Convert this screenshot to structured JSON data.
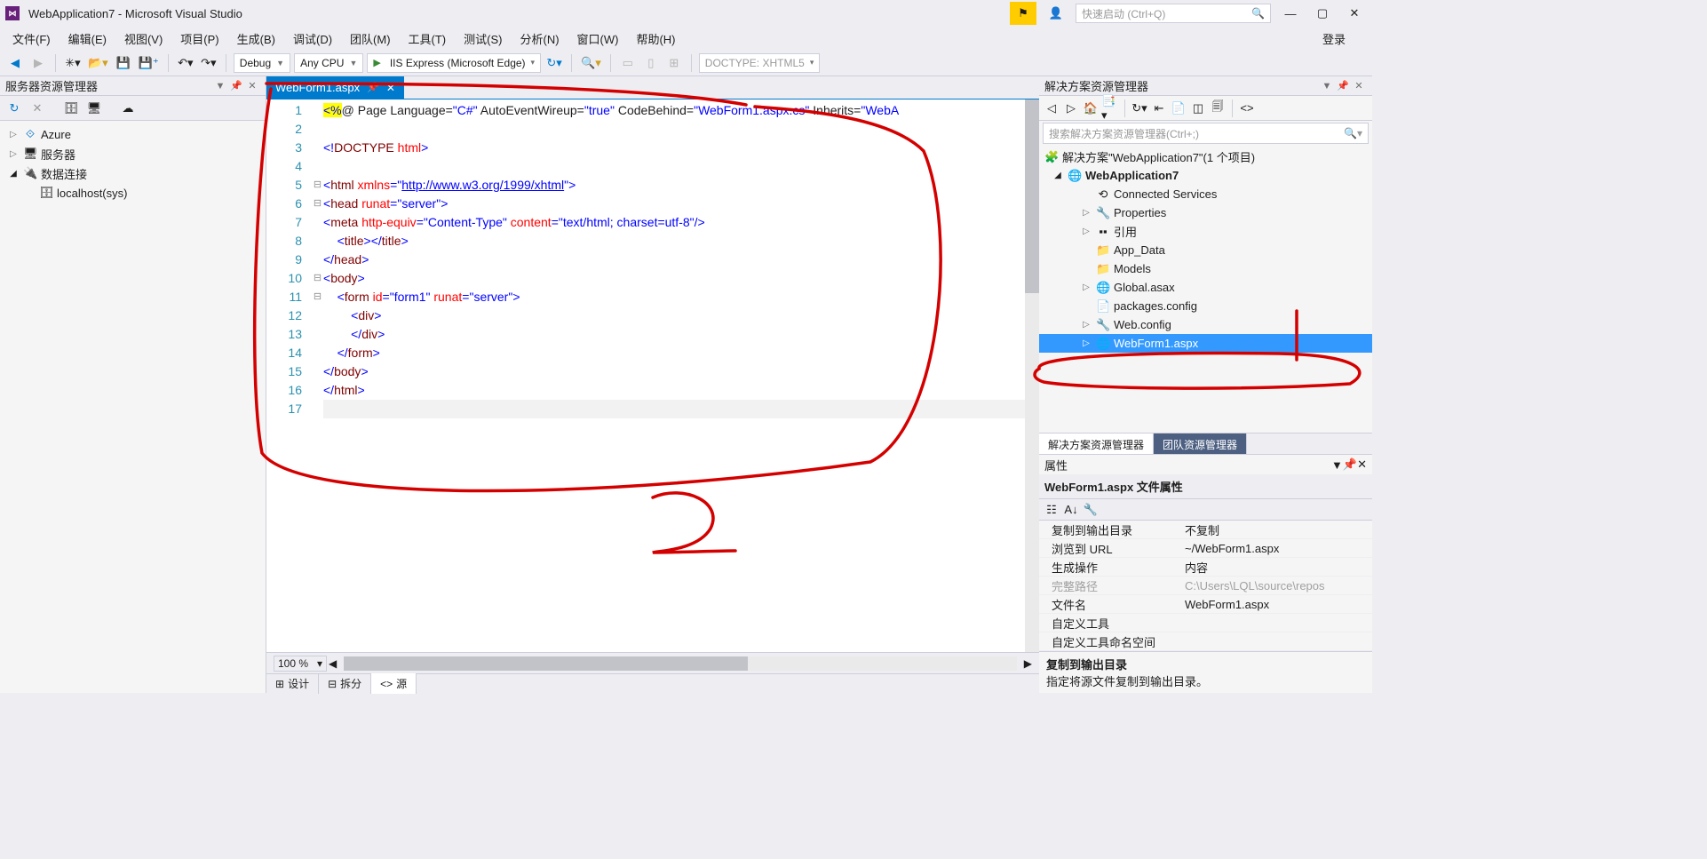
{
  "titlebar": {
    "app_title": "WebApplication7 - Microsoft Visual Studio",
    "quicklaunch_placeholder": "快速启动 (Ctrl+Q)"
  },
  "menus": [
    "文件(F)",
    "编辑(E)",
    "视图(V)",
    "项目(P)",
    "生成(B)",
    "调试(D)",
    "团队(M)",
    "工具(T)",
    "测试(S)",
    "分析(N)",
    "窗口(W)",
    "帮助(H)"
  ],
  "menu_right": "登录",
  "toolbar": {
    "config": "Debug",
    "platform": "Any CPU",
    "run_label": "IIS Express (Microsoft Edge)",
    "doctype": "DOCTYPE: XHTML5"
  },
  "server_explorer": {
    "title": "服务器资源管理器",
    "items": [
      {
        "label": "Azure",
        "icon": "⟐",
        "expand": "▷"
      },
      {
        "label": "服务器",
        "icon": "🖥",
        "expand": "▷"
      },
      {
        "label": "数据连接",
        "icon": "🔌",
        "expand": "◢",
        "children": [
          {
            "label": "localhost(sys)",
            "icon": "🗄"
          }
        ]
      }
    ]
  },
  "editor": {
    "tab_name": "WebForm1.aspx",
    "zoom": "100 %",
    "view_tabs": [
      "设计",
      "拆分",
      "源"
    ],
    "lines": [
      {
        "n": 1,
        "html": "<span class='c-bg'><span class='c-brkt'>&lt;%</span></span>@ Page Language=<span class='c-str'>\"C#\"</span> AutoEventWireup=<span class='c-str'>\"true\"</span> CodeBehind=<span class='c-str'>\"WebForm1.aspx.cs\"</span> Inherits=<span class='c-str'>\"WebA</span>"
      },
      {
        "n": 2,
        "html": ""
      },
      {
        "n": 3,
        "html": "<span class='c-brkt'>&lt;!</span><span class='c-tag'>DOCTYPE</span> <span class='c-attr'>html</span><span class='c-brkt'>&gt;</span>"
      },
      {
        "n": 4,
        "html": ""
      },
      {
        "n": 5,
        "fold": "⊟",
        "html": "<span class='c-brkt'>&lt;</span><span class='c-tag'>html</span> <span class='c-attr'>xmlns</span><span class='c-brkt'>=</span><span class='c-str'>\"<u>http://www.w3.org/1999/xhtml</u>\"</span><span class='c-brkt'>&gt;</span>"
      },
      {
        "n": 6,
        "fold": "⊟",
        "html": "<span class='c-brkt'>&lt;</span><span class='c-tag'>head</span> <span class='c-attr'>runat</span><span class='c-brkt'>=</span><span class='c-str'>\"server\"</span><span class='c-brkt'>&gt;</span>"
      },
      {
        "n": 7,
        "html": "<span class='c-brkt'>&lt;</span><span class='c-tag'>meta</span> <span class='c-attr'>http-equiv</span><span class='c-brkt'>=</span><span class='c-str'>\"Content-Type\"</span> <span class='c-attr'>content</span><span class='c-brkt'>=</span><span class='c-str'>\"text/html; charset=utf-8\"</span><span class='c-brkt'>/&gt;</span>"
      },
      {
        "n": 8,
        "html": "    <span class='c-brkt'>&lt;</span><span class='c-tag'>title</span><span class='c-brkt'>&gt;&lt;/</span><span class='c-tag'>title</span><span class='c-brkt'>&gt;</span>"
      },
      {
        "n": 9,
        "html": "<span class='c-brkt'>&lt;/</span><span class='c-tag'>head</span><span class='c-brkt'>&gt;</span>"
      },
      {
        "n": 10,
        "fold": "⊟",
        "html": "<span class='c-brkt'>&lt;</span><span class='c-tag'>body</span><span class='c-brkt'>&gt;</span>"
      },
      {
        "n": 11,
        "fold": "⊟",
        "html": "    <span class='c-brkt'>&lt;</span><span class='c-tag'>form</span> <span class='c-attr'>id</span><span class='c-brkt'>=</span><span class='c-str'>\"form1\"</span> <span class='c-attr'>runat</span><span class='c-brkt'>=</span><span class='c-str'>\"server\"</span><span class='c-brkt'>&gt;</span>"
      },
      {
        "n": 12,
        "html": "        <span class='c-brkt'>&lt;</span><span class='c-tag'>div</span><span class='c-brkt'>&gt;</span>"
      },
      {
        "n": 13,
        "html": "        <span class='c-brkt'>&lt;/</span><span class='c-tag'>div</span><span class='c-brkt'>&gt;</span>"
      },
      {
        "n": 14,
        "html": "    <span class='c-brkt'>&lt;/</span><span class='c-tag'>form</span><span class='c-brkt'>&gt;</span>"
      },
      {
        "n": 15,
        "html": "<span class='c-brkt'>&lt;/</span><span class='c-tag'>body</span><span class='c-brkt'>&gt;</span>"
      },
      {
        "n": 16,
        "html": "<span class='c-brkt'>&lt;/</span><span class='c-tag'>html</span><span class='c-brkt'>&gt;</span>"
      },
      {
        "n": 17,
        "html": "",
        "cur": true
      }
    ]
  },
  "solution": {
    "title": "解决方案资源管理器",
    "search_placeholder": "搜索解决方案资源管理器(Ctrl+;)",
    "root": "解决方案\"WebApplication7\"(1 个项目)",
    "project": "WebApplication7",
    "nodes": [
      {
        "l": 2,
        "exp": "",
        "icon": "⟲",
        "label": "Connected Services"
      },
      {
        "l": 2,
        "exp": "▷",
        "icon": "🔧",
        "label": "Properties"
      },
      {
        "l": 2,
        "exp": "▷",
        "icon": "▪▪",
        "label": "引用"
      },
      {
        "l": 2,
        "exp": "",
        "icon": "📁",
        "label": "App_Data"
      },
      {
        "l": 2,
        "exp": "",
        "icon": "📁",
        "label": "Models"
      },
      {
        "l": 2,
        "exp": "▷",
        "icon": "🌐",
        "label": "Global.asax"
      },
      {
        "l": 2,
        "exp": "",
        "icon": "📄",
        "label": "packages.config"
      },
      {
        "l": 2,
        "exp": "▷",
        "icon": "🔧",
        "label": "Web.config"
      },
      {
        "l": 2,
        "exp": "▷",
        "icon": "🌐",
        "label": "WebForm1.aspx",
        "sel": true
      }
    ],
    "btabs": [
      "解决方案资源管理器",
      "团队资源管理器"
    ]
  },
  "properties": {
    "title": "属性",
    "subject": "WebForm1.aspx 文件属性",
    "rows": [
      {
        "k": "复制到输出目录",
        "v": "不复制"
      },
      {
        "k": "浏览到 URL",
        "v": "~/WebForm1.aspx"
      },
      {
        "k": "生成操作",
        "v": "内容"
      },
      {
        "k": "完整路径",
        "v": "C:\\Users\\LQL\\source\\repos",
        "dim": true
      },
      {
        "k": "文件名",
        "v": "WebForm1.aspx"
      },
      {
        "k": "自定义工具",
        "v": ""
      },
      {
        "k": "自定义工具命名空间",
        "v": ""
      }
    ],
    "desc_title": "复制到输出目录",
    "desc_body": "指定将源文件复制到输出目录。"
  },
  "annotations": {
    "num1": "1",
    "num2": "2"
  }
}
